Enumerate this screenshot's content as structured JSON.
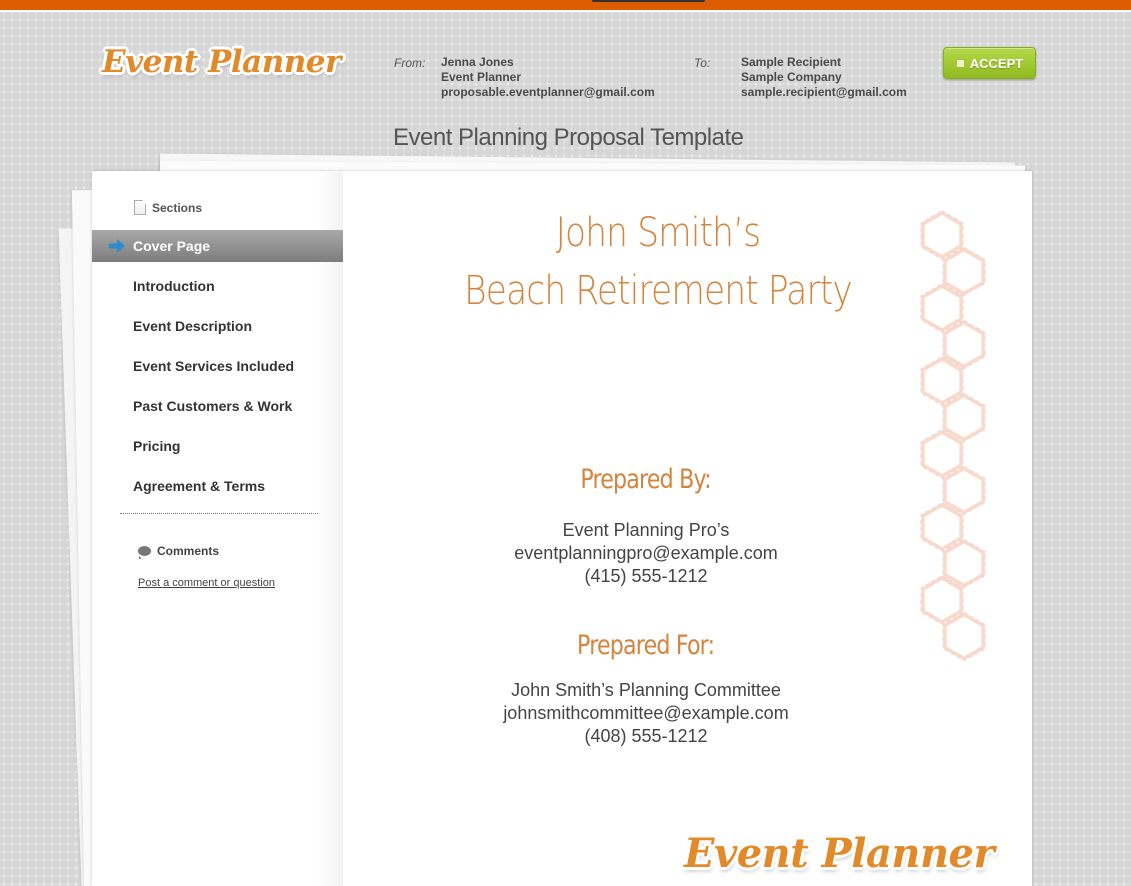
{
  "app": {
    "logo_text": "Event Planner",
    "page_title": "Event Planning Proposal Template",
    "accent_color": "#dc5e00"
  },
  "header": {
    "from": {
      "label": "From:",
      "lines": [
        "Jenna Jones",
        "Event Planner",
        "proposable.eventplanner@gmail.com"
      ]
    },
    "to": {
      "label": "To:",
      "lines": [
        "Sample Recipient",
        "Sample Company",
        "sample.recipient@gmail.com"
      ]
    },
    "accept_button": {
      "label": "ACCEPT",
      "color": "#9cc62f"
    }
  },
  "sidebar": {
    "sections_label": "Sections",
    "items": [
      {
        "label": "Cover Page",
        "active": true
      },
      {
        "label": "Introduction",
        "active": false
      },
      {
        "label": "Event Description",
        "active": false
      },
      {
        "label": "Event Services Included",
        "active": false
      },
      {
        "label": "Past Customers & Work",
        "active": false
      },
      {
        "label": "Pricing",
        "active": false
      },
      {
        "label": "Agreement & Terms",
        "active": false
      }
    ],
    "comments_label": "Comments",
    "comment_link": "Post a comment or question"
  },
  "cover": {
    "title_lines": [
      "John Smith’s",
      "Beach Retirement Party"
    ],
    "title_color": "#d4843c",
    "prepared_by": {
      "heading": "Prepared By:",
      "lines": [
        "Event Planning Pro’s",
        "eventplanningpro@example.com",
        "(415) 555-1212"
      ]
    },
    "prepared_for": {
      "heading": "Prepared For:",
      "lines": [
        "John Smith’s Planning Committee",
        "johnsmithcommittee@example.com",
        "(408) 555-1212"
      ]
    },
    "footer_logo": "Event Planner"
  }
}
